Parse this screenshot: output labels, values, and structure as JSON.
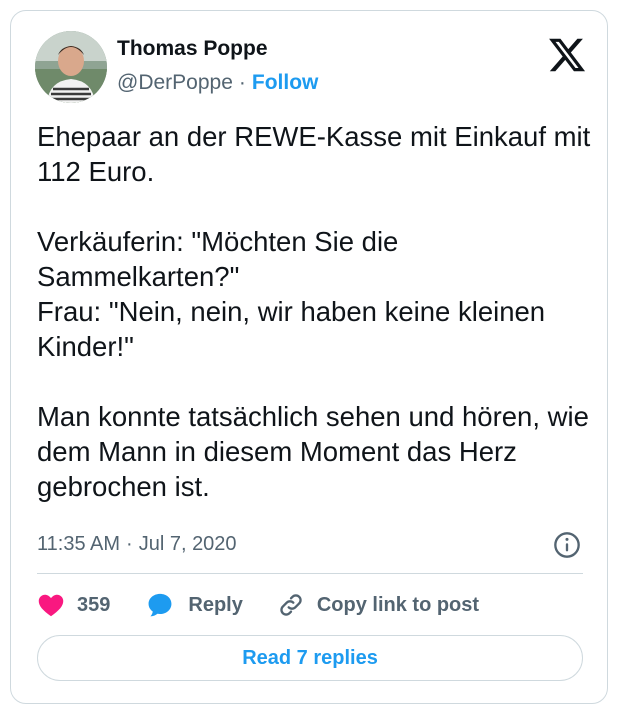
{
  "author": {
    "name": "Thomas Poppe",
    "handle": "@DerPoppe",
    "separator": "·",
    "follow_label": "Follow"
  },
  "tweet": {
    "paragraphs": [
      "Ehepaar an der REWE-Kasse mit Einkauf mit 112 Euro.",
      "Verkäuferin: \"Möchten Sie die Sammelkarten?\"\nFrau: \"Nein, nein, wir haben keine kleinen Kinder!\"",
      "Man konnte tatsächlich sehen und hören, wie dem Mann in diesem Moment das Herz gebrochen ist."
    ],
    "time": "11:35 AM",
    "date": "Jul 7, 2020"
  },
  "actions": {
    "like_count": "359",
    "reply_label": "Reply",
    "copy_link_label": "Copy link to post"
  },
  "read_replies_label": "Read 7 replies",
  "icons": {
    "brand": "x-logo",
    "info": "info-icon",
    "like": "heart-icon",
    "reply": "speech-bubble-icon",
    "link": "link-icon"
  },
  "colors": {
    "accent": "#1d9bf0",
    "like": "#f91880",
    "secondary_text": "#536471",
    "border": "#cfd9de"
  }
}
